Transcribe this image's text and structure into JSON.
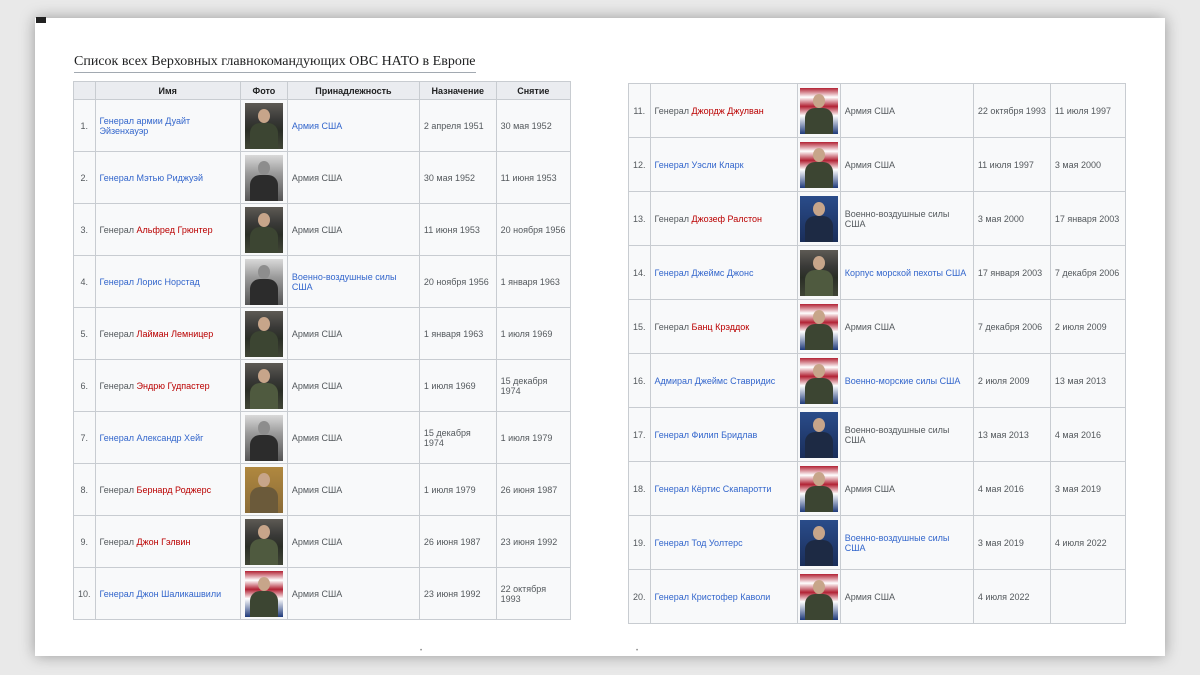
{
  "title": "Список всех Верховных главнокомандующих ОВС НАТО в Европе",
  "headers": {
    "name": "Имя",
    "photo": "Фото",
    "affiliation": "Принадлежность",
    "appointed": "Назначение",
    "removed": "Снятие"
  },
  "colors": {
    "link_blue": "#3366cc",
    "link_red": "#ba0000"
  },
  "left_rows": [
    {
      "num": "1.",
      "rank": "",
      "name": "Генерал армии Дуайт Эйзенхауэр",
      "name_color": "blue",
      "photo": "general-portrait-icon",
      "affiliation": "Армия США",
      "aff_color": "blue",
      "start": "2 апреля 1951",
      "end": "30 мая 1952"
    },
    {
      "num": "2.",
      "rank": "",
      "name": "Генерал Мэтью Риджуэй",
      "name_color": "blue",
      "photo": "general-portrait-icon",
      "affiliation": "Армия США",
      "aff_color": "gray",
      "start": "30 мая 1952",
      "end": "11 июня 1953"
    },
    {
      "num": "3.",
      "rank": "Генерал ",
      "name": "Альфред Грюнтер",
      "name_color": "red",
      "photo": "general-portrait-icon",
      "affiliation": "Армия США",
      "aff_color": "gray",
      "start": "11 июня 1953",
      "end": "20 ноября 1956"
    },
    {
      "num": "4.",
      "rank": "",
      "name": "Генерал Лорис Норстад",
      "name_color": "blue",
      "photo": "general-portrait-icon",
      "affiliation": "Военно-воздушные силы США",
      "aff_color": "blue",
      "start": "20 ноября 1956",
      "end": "1 января 1963"
    },
    {
      "num": "5.",
      "rank": "Генерал ",
      "name": "Лайман Лемницер",
      "name_color": "red",
      "photo": "general-portrait-icon",
      "affiliation": "Армия США",
      "aff_color": "gray",
      "start": "1 января 1963",
      "end": "1 июля 1969"
    },
    {
      "num": "6.",
      "rank": "Генерал ",
      "name": "Эндрю Гудпастер",
      "name_color": "red",
      "photo": "general-portrait-icon",
      "affiliation": "Армия США",
      "aff_color": "gray",
      "start": "1 июля 1969",
      "end": "15 декабря 1974"
    },
    {
      "num": "7.",
      "rank": "",
      "name": "Генерал Александр Хейг",
      "name_color": "blue",
      "photo": "general-portrait-icon",
      "affiliation": "Армия США",
      "aff_color": "gray",
      "start": "15 декабря 1974",
      "end": "1 июля 1979"
    },
    {
      "num": "8.",
      "rank": "Генерал ",
      "name": "Бернард Роджерс",
      "name_color": "red",
      "photo": "general-portrait-icon",
      "affiliation": "Армия США",
      "aff_color": "gray",
      "start": "1 июля 1979",
      "end": "26 июня 1987"
    },
    {
      "num": "9.",
      "rank": "Генерал ",
      "name": "Джон Гэлвин",
      "name_color": "red",
      "photo": "general-portrait-icon",
      "affiliation": "Армия США",
      "aff_color": "gray",
      "start": "26 июня 1987",
      "end": "23 июня 1992"
    },
    {
      "num": "10.",
      "rank": "",
      "name": "Генерал Джон Шаликашвили",
      "name_color": "blue",
      "photo": "general-portrait-icon",
      "affiliation": "Армия США",
      "aff_color": "gray",
      "start": "23 июня 1992",
      "end": "22 октября 1993"
    }
  ],
  "right_rows": [
    {
      "num": "11.",
      "rank": "Генерал ",
      "name": "Джордж Джулван",
      "name_color": "red",
      "photo": "general-portrait-icon",
      "affiliation": "Армия США",
      "aff_color": "gray",
      "start": "22 октября 1993",
      "end": "11 июля 1997"
    },
    {
      "num": "12.",
      "rank": "",
      "name": "Генерал Уэсли Кларк",
      "name_color": "blue",
      "photo": "general-portrait-icon",
      "affiliation": "Армия США",
      "aff_color": "gray",
      "start": "11 июля 1997",
      "end": "3 мая 2000"
    },
    {
      "num": "13.",
      "rank": "Генерал ",
      "name": "Джозеф Ралстон",
      "name_color": "red",
      "photo": "general-portrait-icon",
      "affiliation": "Военно-воздушные силы США",
      "aff_color": "gray",
      "start": "3 мая 2000",
      "end": "17 января 2003"
    },
    {
      "num": "14.",
      "rank": "",
      "name": "Генерал Джеймс Джонс",
      "name_color": "blue",
      "photo": "general-portrait-icon",
      "affiliation": "Корпус морской пехоты США",
      "aff_color": "blue",
      "start": "17 января 2003",
      "end": "7 декабря 2006"
    },
    {
      "num": "15.",
      "rank": "Генерал ",
      "name": "Банц Крэддок",
      "name_color": "red",
      "photo": "general-portrait-icon",
      "affiliation": "Армия США",
      "aff_color": "gray",
      "start": "7 декабря 2006",
      "end": "2 июля 2009"
    },
    {
      "num": "16.",
      "rank": "",
      "name": "Адмирал Джеймс Ставридис",
      "name_color": "blue",
      "photo": "admiral-portrait-icon",
      "affiliation": "Военно-морские силы США",
      "aff_color": "blue",
      "start": "2 июля 2009",
      "end": "13 мая 2013"
    },
    {
      "num": "17.",
      "rank": "",
      "name": "Генерал Филип Бридлав",
      "name_color": "blue",
      "photo": "general-portrait-icon",
      "affiliation": "Военно-воздушные силы США",
      "aff_color": "gray",
      "start": "13 мая 2013",
      "end": "4 мая 2016"
    },
    {
      "num": "18.",
      "rank": "",
      "name": "Генерал Кёртис Скапаротти",
      "name_color": "blue",
      "photo": "general-portrait-icon",
      "affiliation": "Армия США",
      "aff_color": "gray",
      "start": "4 мая 2016",
      "end": "3 мая 2019"
    },
    {
      "num": "19.",
      "rank": "",
      "name": "Генерал Тод Уолтерс",
      "name_color": "blue",
      "photo": "general-portrait-icon",
      "affiliation": "Военно-воздушные силы США",
      "aff_color": "blue",
      "start": "3 мая 2019",
      "end": "4 июля 2022"
    },
    {
      "num": "20.",
      "rank": "",
      "name": "Генерал Кристофер Каволи",
      "name_color": "blue",
      "photo": "general-portrait-icon",
      "affiliation": "Армия США",
      "aff_color": "gray",
      "start": "4 июля 2022",
      "end": ""
    }
  ]
}
